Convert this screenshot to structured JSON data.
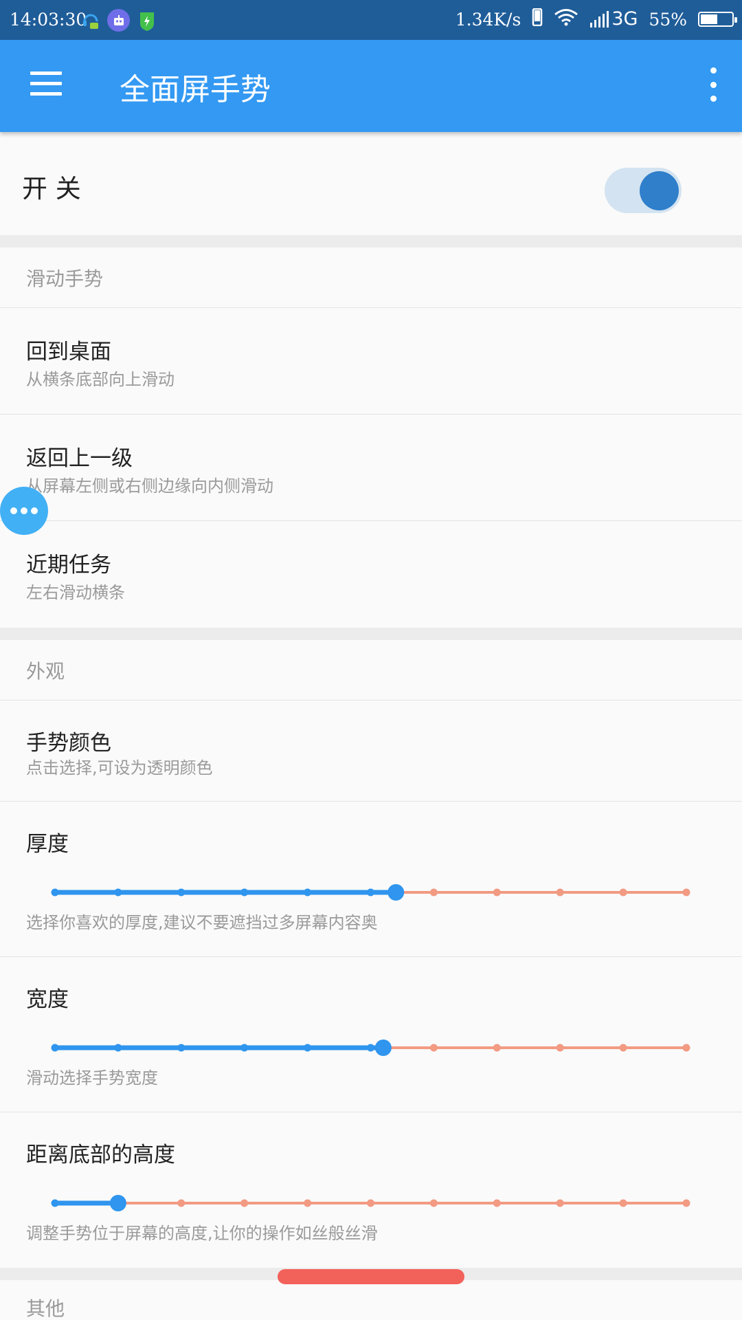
{
  "status_bar": {
    "time": "14:03:30",
    "net_speed": "1.34K/s",
    "network": "3G",
    "battery_text": "55%",
    "battery_level": 0.55,
    "icons": [
      "headset-chat-icon",
      "robot-icon",
      "shield-bolt-icon",
      "phone-icon",
      "wifi-icon",
      "signal-icon",
      "battery-icon"
    ]
  },
  "app_bar": {
    "title": "全面屏手势",
    "menu_icon": "hamburger-menu-icon",
    "more_icon": "more-vert-icon"
  },
  "switch_row": {
    "label": "开 关",
    "checked": true,
    "accent": "#2f7fcb"
  },
  "gestures": {
    "header": "滑动手势",
    "items": [
      {
        "title": "回到桌面",
        "subtitle": "从横条底部向上滑动"
      },
      {
        "title": "返回上一级",
        "subtitle": "从屏幕左侧或右侧边缘向内侧滑动"
      },
      {
        "title": "近期任务",
        "subtitle": "左右滑动横条"
      }
    ]
  },
  "appearance": {
    "header": "外观",
    "color_item": {
      "title": "手势颜色",
      "subtitle": "点击选择,可设为透明颜色"
    },
    "sliders": [
      {
        "title": "厚度",
        "subtitle": "选择你喜欢的厚度,建议不要遮挡过多屏幕内容奥",
        "value": 0.54
      },
      {
        "title": "宽度",
        "subtitle": "滑动选择手势宽度",
        "value": 0.52
      },
      {
        "title": "距离底部的高度",
        "subtitle": "调整手势位于屏幕的高度,让你的操作如丝般丝滑",
        "value": 0.1
      }
    ],
    "active_color": "#2f95ee",
    "inactive_color": "#f29a82",
    "ticks": 11
  },
  "other": {
    "header": "其他"
  },
  "float_button_icon": "more-horiz-icon",
  "scroll_indicator_color": "#f2625a"
}
